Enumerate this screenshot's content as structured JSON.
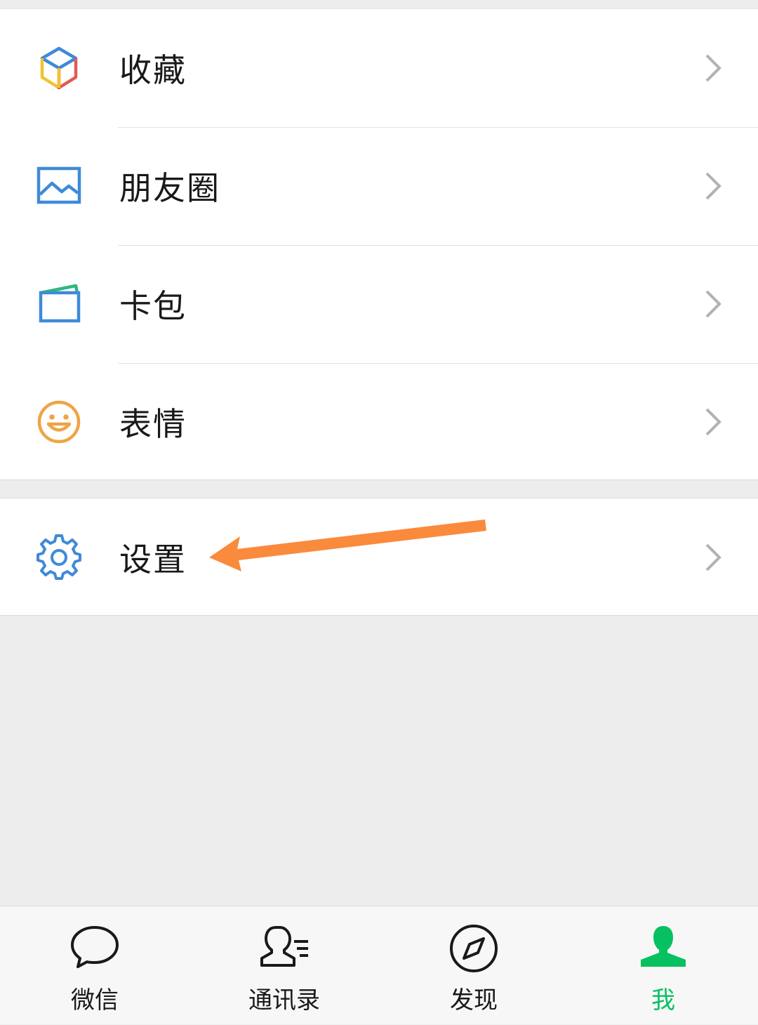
{
  "menu": {
    "items": [
      {
        "label": "收藏",
        "icon": "favorites-cube-icon"
      },
      {
        "label": "朋友圈",
        "icon": "moments-image-icon"
      },
      {
        "label": "卡包",
        "icon": "card-wallet-icon"
      },
      {
        "label": "表情",
        "icon": "sticker-smiley-icon"
      }
    ],
    "settings": {
      "label": "设置",
      "icon": "settings-gear-icon"
    }
  },
  "tabbar": {
    "tabs": [
      {
        "label": "微信",
        "icon": "chat-bubble-icon",
        "active": false
      },
      {
        "label": "通讯录",
        "icon": "contacts-icon",
        "active": false
      },
      {
        "label": "发现",
        "icon": "compass-icon",
        "active": false
      },
      {
        "label": "我",
        "icon": "person-icon",
        "active": true
      }
    ]
  },
  "annotation": {
    "type": "arrow",
    "color": "#fa8a3c",
    "target": "设置"
  },
  "colors": {
    "accent_active": "#07c160",
    "background": "#ededed",
    "row_background": "#ffffff",
    "chevron": "#b2b2b2"
  }
}
